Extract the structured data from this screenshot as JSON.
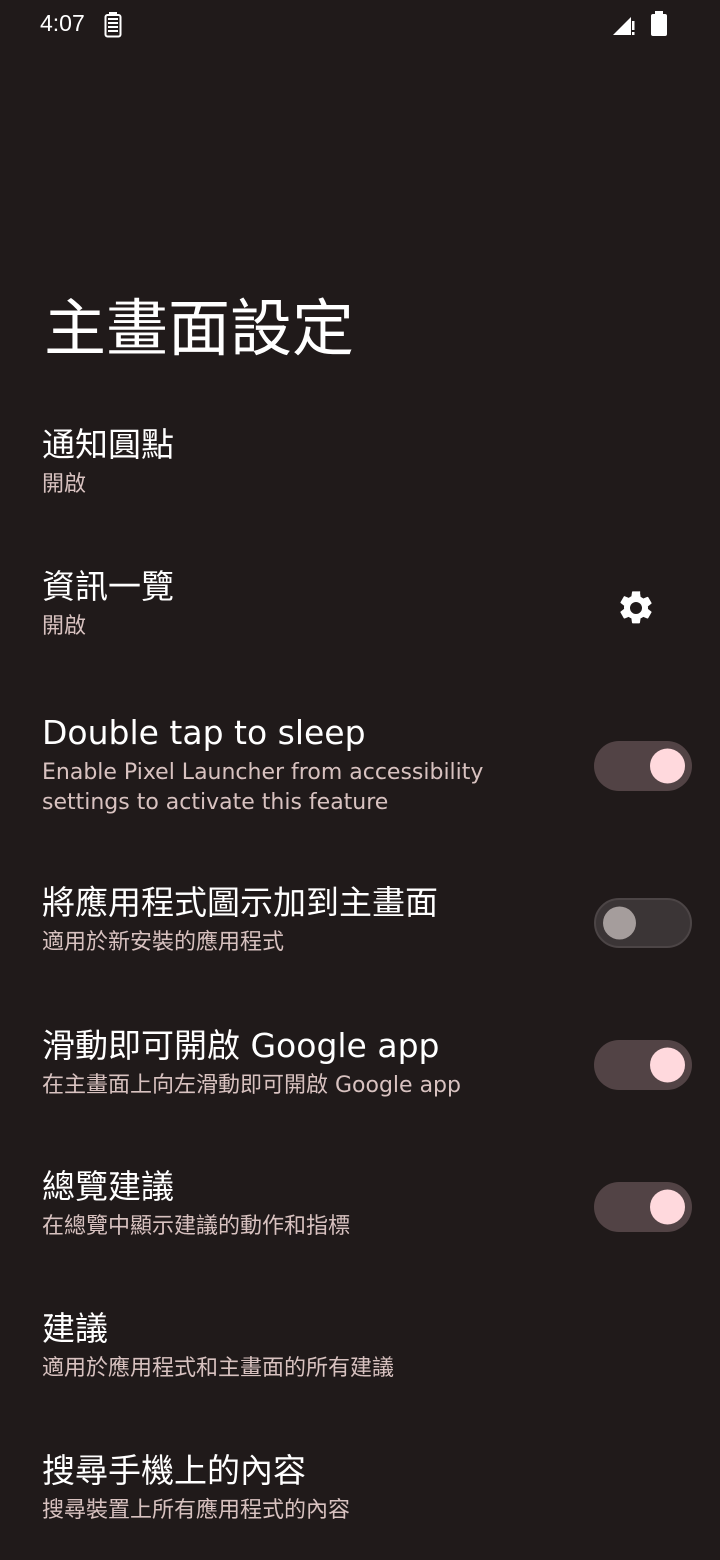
{
  "status_bar": {
    "time": "4:07"
  },
  "page": {
    "title": "主畫面設定"
  },
  "settings": [
    {
      "title": "通知圓點",
      "subtitle": "開啟"
    },
    {
      "title": "資訊一覽",
      "subtitle": "開啟",
      "icon": "gear-icon"
    },
    {
      "title": "Double tap to sleep",
      "subtitle": "Enable Pixel Launcher from accessibility settings to activate this feature",
      "toggle": "on"
    },
    {
      "title": "將應用程式圖示加到主畫面",
      "subtitle": "適用於新安裝的應用程式",
      "toggle": "off"
    },
    {
      "title": "滑動即可開啟 Google app",
      "subtitle": "在主畫面上向左滑動即可開啟 Google app",
      "toggle": "on"
    },
    {
      "title": "總覽建議",
      "subtitle": "在總覽中顯示建議的動作和指標",
      "toggle": "on"
    },
    {
      "title": "建議",
      "subtitle": "適用於應用程式和主畫面的所有建議"
    },
    {
      "title": "搜尋手機上的內容",
      "subtitle": "搜尋裝置上所有應用程式的內容"
    }
  ],
  "colors": {
    "background": "#201a1a",
    "toggle_thumb_on": "#ffd9dd",
    "toggle_track_on": "#524345"
  }
}
